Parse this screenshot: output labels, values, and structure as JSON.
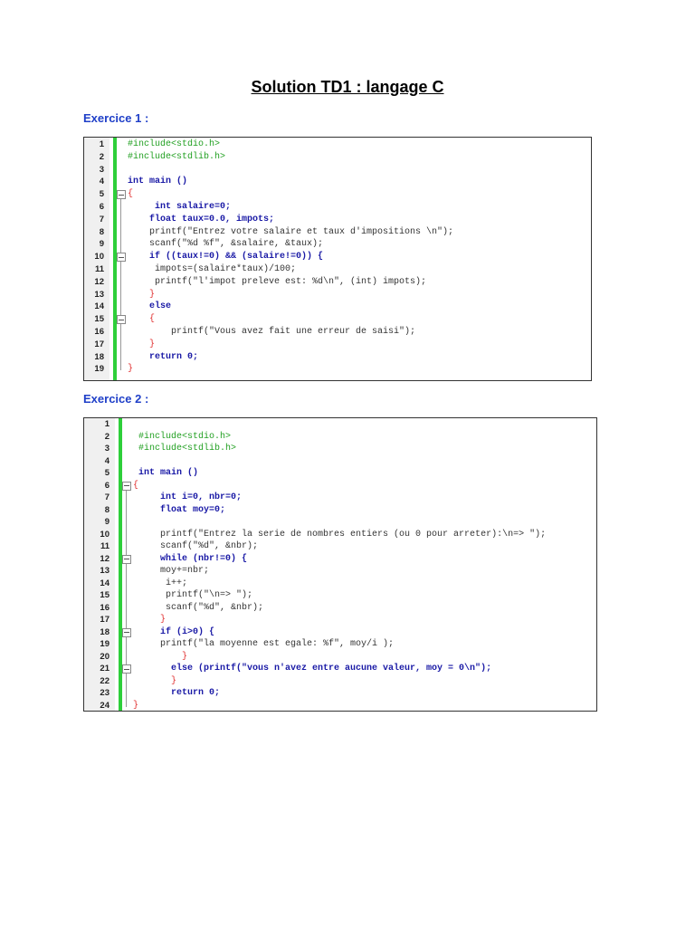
{
  "title": "Solution TD1 : langage C",
  "exercises": [
    {
      "heading": "Exercice 1 :",
      "lines": [
        "#include<stdio.h>",
        "#include<stdlib.h>",
        "",
        "int main ()",
        "{",
        "     int salaire=0;",
        "    float taux=0.0, impots;",
        "    printf(\"Entrez votre salaire et taux d'impositions \\n\");",
        "    scanf(\"%d %f\", &salaire, &taux);",
        "    if ((taux!=0) && (salaire!=0)) {",
        "     impots=(salaire*taux)/100;",
        "     printf(\"l'impot preleve est: %d\\n\", (int) impots);",
        "    }",
        "    else",
        "    {",
        "        printf(\"Vous avez fait une erreur de saisi\");",
        "    }",
        "    return 0;",
        "}"
      ]
    },
    {
      "heading": "Exercice 2 :",
      "lines": [
        "",
        " #include<stdio.h>",
        " #include<stdlib.h>",
        "",
        " int main ()",
        "{",
        "     int i=0, nbr=0;",
        "     float moy=0;",
        "",
        "     printf(\"Entrez la serie de nombres entiers (ou 0 pour arreter):\\n=> \");",
        "     scanf(\"%d\", &nbr);",
        "     while (nbr!=0) {",
        "     moy+=nbr;",
        "      i++;",
        "      printf(\"\\n=> \");",
        "      scanf(\"%d\", &nbr);",
        "     }",
        "     if (i>0) {",
        "     printf(\"la moyenne est egale: %f\", moy/i );",
        "         }",
        "       else (printf(\"vous n'avez entre aucune valeur, moy = 0\\n\");",
        "       }",
        "       return 0;",
        "}"
      ]
    }
  ]
}
